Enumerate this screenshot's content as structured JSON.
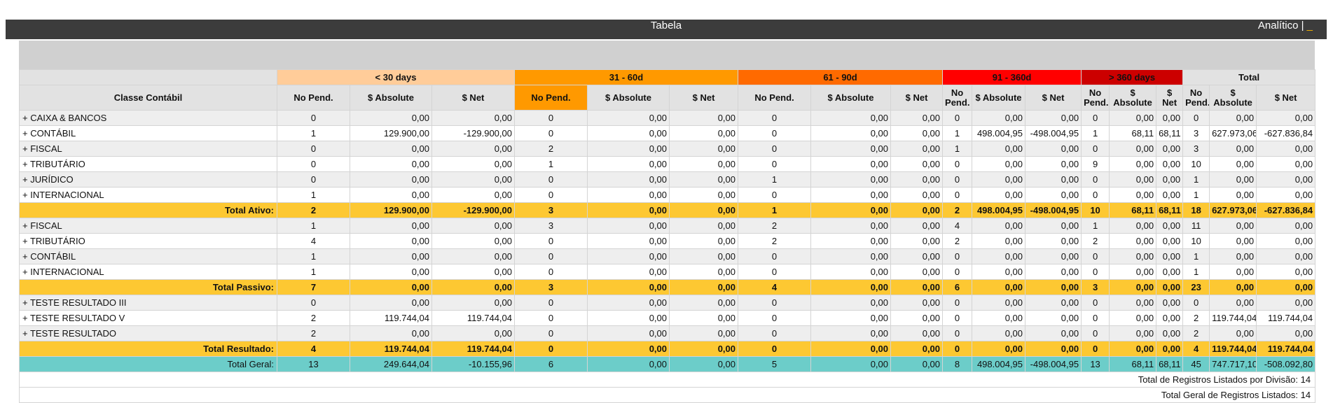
{
  "header": {
    "title": "Tabela",
    "mode_label": "Analítico |",
    "mode_cursor": "_"
  },
  "table": {
    "first_column_header": "Classe Contábil",
    "groups": [
      {
        "label": "< 30 days",
        "color": "#ffcc99"
      },
      {
        "label": "31 - 60d",
        "color": "#ff9900"
      },
      {
        "label": "61 - 90d",
        "color": "#ff6a00"
      },
      {
        "label": "91 - 360d",
        "color": "#ff0000"
      },
      {
        "label": "> 360 days",
        "color": "#cc0000"
      },
      {
        "label": "Total",
        "color": "#e2e2e2"
      }
    ],
    "sub_headers": [
      "No Pend.",
      "$ Absolute",
      "$ Net"
    ],
    "rows": [
      {
        "type": "data",
        "label": "+ CAIXA & BANCOS",
        "cells": [
          "0",
          "0,00",
          "0,00",
          "0",
          "0,00",
          "0,00",
          "0",
          "0,00",
          "0,00",
          "0",
          "0,00",
          "0,00",
          "0",
          "0,00",
          "0,00",
          "0",
          "0,00",
          "0,00"
        ]
      },
      {
        "type": "data",
        "label": "+ CONTÁBIL",
        "cells": [
          "1",
          "129.900,00",
          "-129.900,00",
          "0",
          "0,00",
          "0,00",
          "0",
          "0,00",
          "0,00",
          "1",
          "498.004,95",
          "-498.004,95",
          "1",
          "68,11",
          "68,11",
          "3",
          "627.973,06",
          "-627.836,84"
        ]
      },
      {
        "type": "data",
        "label": "+ FISCAL",
        "cells": [
          "0",
          "0,00",
          "0,00",
          "2",
          "0,00",
          "0,00",
          "0",
          "0,00",
          "0,00",
          "1",
          "0,00",
          "0,00",
          "0",
          "0,00",
          "0,00",
          "3",
          "0,00",
          "0,00"
        ]
      },
      {
        "type": "data",
        "label": "+ TRIBUTÁRIO",
        "cells": [
          "0",
          "0,00",
          "0,00",
          "1",
          "0,00",
          "0,00",
          "0",
          "0,00",
          "0,00",
          "0",
          "0,00",
          "0,00",
          "9",
          "0,00",
          "0,00",
          "10",
          "0,00",
          "0,00"
        ]
      },
      {
        "type": "data",
        "label": "+ JURÍDICO",
        "cells": [
          "0",
          "0,00",
          "0,00",
          "0",
          "0,00",
          "0,00",
          "1",
          "0,00",
          "0,00",
          "0",
          "0,00",
          "0,00",
          "0",
          "0,00",
          "0,00",
          "1",
          "0,00",
          "0,00"
        ]
      },
      {
        "type": "data",
        "label": "+ INTERNACIONAL",
        "cells": [
          "1",
          "0,00",
          "0,00",
          "0",
          "0,00",
          "0,00",
          "0",
          "0,00",
          "0,00",
          "0",
          "0,00",
          "0,00",
          "0",
          "0,00",
          "0,00",
          "1",
          "0,00",
          "0,00"
        ]
      },
      {
        "type": "total",
        "label": "Total Ativo:",
        "cells": [
          "2",
          "129.900,00",
          "-129.900,00",
          "3",
          "0,00",
          "0,00",
          "1",
          "0,00",
          "0,00",
          "2",
          "498.004,95",
          "-498.004,95",
          "10",
          "68,11",
          "68,11",
          "18",
          "627.973,06",
          "-627.836,84"
        ]
      },
      {
        "type": "data",
        "label": "+ FISCAL",
        "cells": [
          "1",
          "0,00",
          "0,00",
          "3",
          "0,00",
          "0,00",
          "2",
          "0,00",
          "0,00",
          "4",
          "0,00",
          "0,00",
          "1",
          "0,00",
          "0,00",
          "11",
          "0,00",
          "0,00"
        ]
      },
      {
        "type": "data",
        "label": "+ TRIBUTÁRIO",
        "cells": [
          "4",
          "0,00",
          "0,00",
          "0",
          "0,00",
          "0,00",
          "2",
          "0,00",
          "0,00",
          "2",
          "0,00",
          "0,00",
          "2",
          "0,00",
          "0,00",
          "10",
          "0,00",
          "0,00"
        ]
      },
      {
        "type": "data",
        "label": "+ CONTÁBIL",
        "cells": [
          "1",
          "0,00",
          "0,00",
          "0",
          "0,00",
          "0,00",
          "0",
          "0,00",
          "0,00",
          "0",
          "0,00",
          "0,00",
          "0",
          "0,00",
          "0,00",
          "1",
          "0,00",
          "0,00"
        ]
      },
      {
        "type": "data",
        "label": "+ INTERNACIONAL",
        "cells": [
          "1",
          "0,00",
          "0,00",
          "0",
          "0,00",
          "0,00",
          "0",
          "0,00",
          "0,00",
          "0",
          "0,00",
          "0,00",
          "0",
          "0,00",
          "0,00",
          "1",
          "0,00",
          "0,00"
        ]
      },
      {
        "type": "total",
        "label": "Total Passivo:",
        "cells": [
          "7",
          "0,00",
          "0,00",
          "3",
          "0,00",
          "0,00",
          "4",
          "0,00",
          "0,00",
          "6",
          "0,00",
          "0,00",
          "3",
          "0,00",
          "0,00",
          "23",
          "0,00",
          "0,00"
        ]
      },
      {
        "type": "data",
        "label": "+ TESTE RESULTADO III",
        "cells": [
          "0",
          "0,00",
          "0,00",
          "0",
          "0,00",
          "0,00",
          "0",
          "0,00",
          "0,00",
          "0",
          "0,00",
          "0,00",
          "0",
          "0,00",
          "0,00",
          "0",
          "0,00",
          "0,00"
        ]
      },
      {
        "type": "data",
        "label": "+ TESTE RESULTADO V",
        "cells": [
          "2",
          "119.744,04",
          "119.744,04",
          "0",
          "0,00",
          "0,00",
          "0",
          "0,00",
          "0,00",
          "0",
          "0,00",
          "0,00",
          "0",
          "0,00",
          "0,00",
          "2",
          "119.744,04",
          "119.744,04"
        ]
      },
      {
        "type": "data",
        "label": "+ TESTE RESULTADO",
        "cells": [
          "2",
          "0,00",
          "0,00",
          "0",
          "0,00",
          "0,00",
          "0",
          "0,00",
          "0,00",
          "0",
          "0,00",
          "0,00",
          "0",
          "0,00",
          "0,00",
          "2",
          "0,00",
          "0,00"
        ]
      },
      {
        "type": "total",
        "label": "Total Resultado:",
        "cells": [
          "4",
          "119.744,04",
          "119.744,04",
          "0",
          "0,00",
          "0,00",
          "0",
          "0,00",
          "0,00",
          "0",
          "0,00",
          "0,00",
          "0",
          "0,00",
          "0,00",
          "4",
          "119.744,04",
          "119.744,04"
        ]
      },
      {
        "type": "grand",
        "label": "Total Geral:",
        "cells": [
          "13",
          "249.644,04",
          "-10.155,96",
          "6",
          "0,00",
          "0,00",
          "5",
          "0,00",
          "0,00",
          "8",
          "498.004,95",
          "-498.004,95",
          "13",
          "68,11",
          "68,11",
          "45",
          "747.717,10",
          "-508.092,80"
        ]
      }
    ],
    "footer": [
      "Total de Registros Listados por Divisão: 14",
      "Total Geral de Registros Listados: 14"
    ],
    "colors": {
      "total_row": "#fdc832",
      "grand_row": "#6ccdc9",
      "row_odd": "#eeeeee",
      "row_even": "#ffffff",
      "header_bar": "#3c3c3c"
    }
  }
}
